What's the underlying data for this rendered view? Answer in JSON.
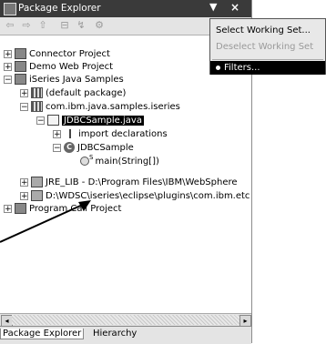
{
  "window": {
    "title": "Package Explorer",
    "view_menu_glyph": "▼",
    "close_glyph": "×"
  },
  "toolbar": [
    {
      "icon": "back-icon",
      "glyph": "⇦"
    },
    {
      "icon": "forward-icon",
      "glyph": "⇨"
    },
    {
      "icon": "up-icon",
      "glyph": "⇧"
    },
    {
      "icon": "collapse-all-icon",
      "glyph": "⊟"
    },
    {
      "icon": "link-editor-icon",
      "glyph": "↯"
    },
    {
      "icon": "settings-icon",
      "glyph": "⚙"
    }
  ],
  "tree": [
    {
      "label": "Connector Project",
      "icon": "project-icon",
      "expander": "+"
    },
    {
      "label": "Demo Web Project",
      "icon": "project-icon",
      "expander": "+"
    },
    {
      "label": "iSeries Java Samples",
      "icon": "project-icon",
      "expander": "−"
    },
    {
      "label": "(default package)",
      "icon": "package-icon",
      "expander": "+"
    },
    {
      "label": "com.ibm.java.samples.iseries",
      "icon": "package-icon",
      "expander": "−"
    },
    {
      "label": "JDBCSample.java",
      "icon": "java-file-icon",
      "expander": "−",
      "selected": true
    },
    {
      "label": "import declarations",
      "icon": "imports-icon",
      "expander": "+"
    },
    {
      "label": "JDBCSample",
      "icon": "class-icon",
      "expander": "−",
      "class_glyph": "C"
    },
    {
      "label": "main(String[])",
      "icon": "method-icon",
      "expander": "",
      "static_marker": "S"
    },
    {
      "label": "JRE_LIB - D:\\Program Files\\IBM\\WebSphere",
      "icon": "jar-icon",
      "expander": "+"
    },
    {
      "label": "D:\\WDSC\\iseries\\eclipse\\plugins\\com.ibm.etc",
      "icon": "jar-icon",
      "expander": "+"
    },
    {
      "label": "Program Call Project",
      "icon": "project-icon",
      "expander": "+"
    }
  ],
  "scrollbar": {
    "left_glyph": "◂",
    "right_glyph": "▸"
  },
  "tabs": [
    {
      "label": "Package Explorer",
      "active": true
    },
    {
      "label": "Hierarchy",
      "active": false
    }
  ],
  "view_menu": {
    "items": [
      {
        "label": "Select Working Set...",
        "enabled": true
      },
      {
        "label": "Deselect Working Set",
        "enabled": false
      },
      {
        "label": "Filters...",
        "enabled": true,
        "highlighted": true
      }
    ]
  }
}
